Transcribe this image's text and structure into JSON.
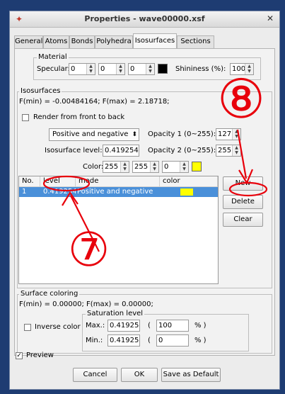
{
  "window": {
    "title": "Properties - wave00000.xsf"
  },
  "tabs": [
    {
      "label": "General"
    },
    {
      "label": "Atoms"
    },
    {
      "label": "Bonds"
    },
    {
      "label": "Polyhedra"
    },
    {
      "label": "Isosurfaces",
      "active": true
    },
    {
      "label": "Sections"
    }
  ],
  "material": {
    "title": "Material",
    "specular_label": "Specular:",
    "specular": [
      "0",
      "0",
      "0"
    ],
    "shininess_label": "Shininess (%):",
    "shininess": "100"
  },
  "isosurfaces": {
    "title": "Isosurfaces",
    "range_text": "F(min) = -0.00484164;   F(max) = 2.18718;",
    "render_label": "Render from front to back",
    "mode_value": "Positive and negative",
    "opacity1_label": "Opacity 1 (0~255):",
    "opacity1": "127",
    "level_label": "Isosurface level:",
    "level_value": "0.419254",
    "opacity2_label": "Opacity 2 (0~255):",
    "opacity2": "255",
    "color_label": "Color:",
    "color": [
      "255",
      "255",
      "0"
    ],
    "columns": [
      "No.",
      "level",
      "mode",
      "color"
    ],
    "rows": [
      {
        "no": "1",
        "level": "0.419254",
        "mode": "Positive and negative",
        "color_hex": "#ffff00"
      }
    ],
    "new_label": "New",
    "delete_label": "Delete",
    "clear_label": "Clear"
  },
  "surface_coloring": {
    "title": "Surface coloring",
    "range_text": "F(min) = 0.00000;   F(max) = 0.00000;",
    "inverse_label": "Inverse color",
    "saturation_title": "Saturation level",
    "max_label": "Max.:",
    "max_value": "0.419254",
    "max_pct": "100",
    "min_label": "Min.:",
    "min_value": "0.419254",
    "min_pct": "0",
    "open_paren": "(",
    "pct_suffix": "% )"
  },
  "footer": {
    "preview_label": "Preview",
    "cancel_label": "Cancel",
    "ok_label": "OK",
    "save_default_label": "Save as Default"
  },
  "annotations": {
    "circle_7": "⑦",
    "circle_8": "⑧"
  },
  "colors": {
    "annotation": "#e8000b",
    "selection": "#4a90d9",
    "swatch_yellow": "#ffff00",
    "swatch_black": "#000000"
  }
}
